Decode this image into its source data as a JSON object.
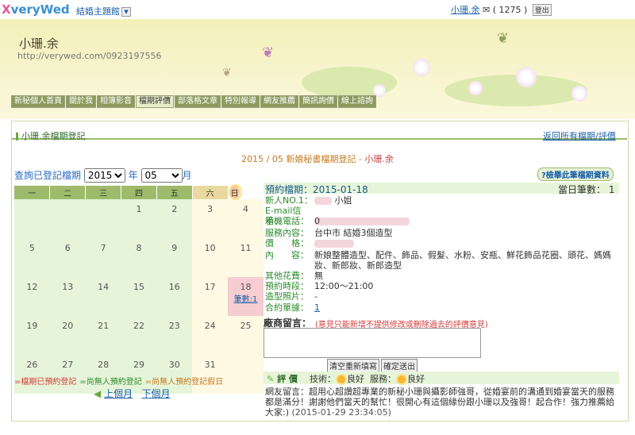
{
  "header": {
    "logo_prefix": "X",
    "logo_text": "veryWed",
    "site_link": "結婚主題館",
    "user_name": "小珊.余",
    "message_count": "( 1275 )",
    "logout": "登出"
  },
  "banner": {
    "name": "小珊.余",
    "url": "http://verywed.com/0923197556",
    "nav": [
      "新秘個人首頁",
      "關於我",
      "相簿影音",
      "檔期評價",
      "部落格文章",
      "特別報導",
      "網友推薦",
      "簡訊詢價",
      "線上諮詢"
    ],
    "active_nav": "檔期評價"
  },
  "panel": {
    "title": "小珊.余檔期登記",
    "back_link": "返回所有檔期/評價",
    "center_title": "2015 / 05 新娘秘書檔期登記 - ",
    "center_name": "小珊.余"
  },
  "query": {
    "label": "查詢已登記檔期",
    "year": "2015",
    "year_unit": "年",
    "month": "05",
    "month_unit": "月"
  },
  "print_button": "?檢舉此筆檔期資料",
  "calendar": {
    "weekdays": [
      "一",
      "二",
      "三",
      "四",
      "五",
      "六",
      "日"
    ],
    "weeks": [
      [
        "",
        "",
        "",
        "1",
        "2",
        "3",
        "4"
      ],
      [
        "5",
        "6",
        "7",
        "8",
        "9",
        "10",
        "11"
      ],
      [
        "12",
        "13",
        "14",
        "15",
        "16",
        "17",
        "18"
      ],
      [
        "19",
        "20",
        "21",
        "22",
        "23",
        "24",
        "25"
      ],
      [
        "26",
        "27",
        "28",
        "29",
        "30",
        "31",
        ""
      ]
    ],
    "booked_count_label": "筆數:1"
  },
  "legend": {
    "booked": "=檔期已預約登記",
    "no_booking": "=尚無人預約登記",
    "no_booking_holiday": "=尚無人預約登記假日"
  },
  "month_nav": {
    "prev": "上個月",
    "next": "下個月"
  },
  "details": {
    "date_label": "預約檔期：2015-01-18",
    "day_count": "當日筆數： 1",
    "rows": [
      {
        "label": "新人NO.1：",
        "value": "小姐"
      },
      {
        "label": "E-mail信箱：",
        "value": ""
      },
      {
        "label": "手機電話：",
        "value": "0"
      },
      {
        "label": "服務內容：",
        "value": "台中市 結婚3個造型"
      },
      {
        "label": "價　　格：",
        "value": ""
      },
      {
        "label": "內　　容：",
        "value": "新娘整體造型、配件、飾品、假髮、水粉、安瓶、鮮花飾品花圈、頭花、媽媽妝、新郎妝、新郎造型"
      },
      {
        "label": "其他花費：",
        "value": "無"
      },
      {
        "label": "預約時段：",
        "value": "12:00～21:00"
      },
      {
        "label": "造型照片：",
        "value": "-"
      },
      {
        "label": "合約單據：",
        "value": "1"
      }
    ]
  },
  "message": {
    "label": "廠商留言：",
    "note": "(意見只能新增不提供修改或刪除過去的評價意見)",
    "clear_button": "清空重新填寫",
    "send_button": "確定送出"
  },
  "rating": {
    "title": "評 價",
    "technique_label": "技術：",
    "technique_value": "良好",
    "service_label": "服務：",
    "service_value": "良好",
    "review": "網友留言：超用心超讚超專業的新秘小珊與攝影師強哥，從婚宴前的溝通到婚宴當天的服務都是滿分！謝謝他們當天的幫忙！很開心有這個緣份跟小珊以及強哥！起合作！強力推薦給大家:)",
    "timestamp": "(2015-01-29 23:34:05)"
  },
  "colors": {
    "accent_green": "#9dbb6a",
    "booked_pink": "#f6cdd0",
    "link_blue": "#1a5fa8",
    "alert_red": "#d23c3c"
  }
}
